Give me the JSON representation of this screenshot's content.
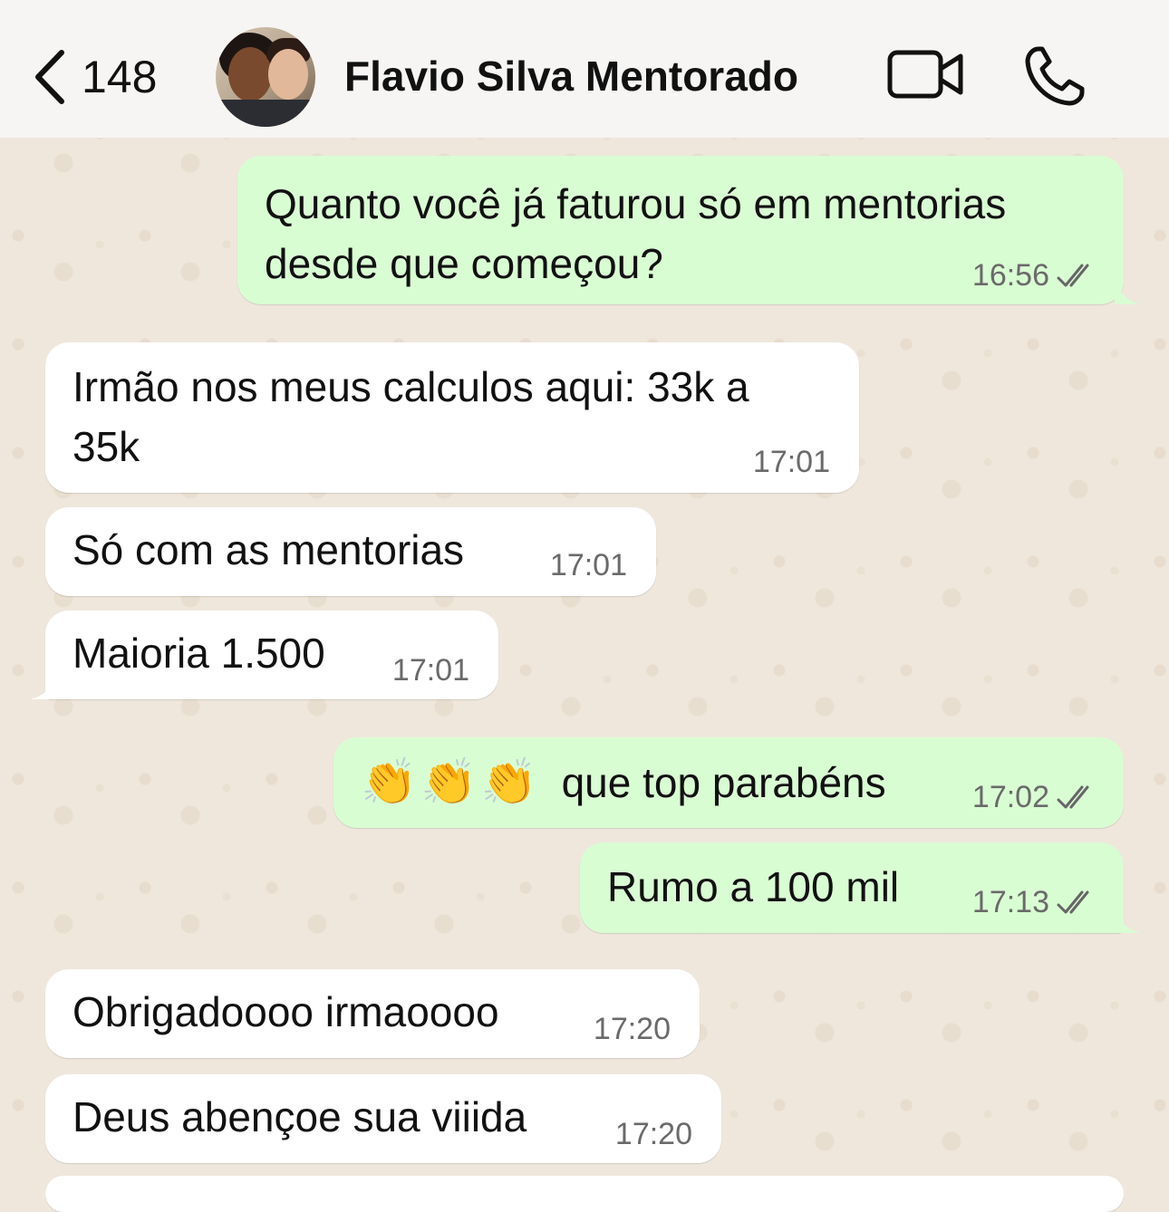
{
  "header": {
    "unread_count": "148",
    "contact_name": "Flavio Silva Mentorado",
    "back_icon": "chevron-left-icon",
    "video_icon": "video-camera-icon",
    "phone_icon": "phone-icon"
  },
  "messages": [
    {
      "direction": "outgoing",
      "lines": [
        "Quanto você já faturou só em mentorias",
        "desde que começou?"
      ],
      "time": "16:56",
      "status": "read"
    },
    {
      "direction": "incoming",
      "lines": [
        "Irmão nos meus calculos aqui: 33k a",
        "35k"
      ],
      "time": "17:01"
    },
    {
      "direction": "incoming",
      "text": "Só com as mentorias",
      "time": "17:01"
    },
    {
      "direction": "incoming",
      "text": "Maioria 1.500",
      "time": "17:01"
    },
    {
      "direction": "outgoing",
      "emoji": "👏👏👏",
      "text": "que top parabéns",
      "time": "17:02",
      "status": "read"
    },
    {
      "direction": "outgoing",
      "text": "Rumo a 100 mil",
      "time": "17:13",
      "status": "read"
    },
    {
      "direction": "incoming",
      "text": "Obrigadoooo irmaoooo",
      "time": "17:20"
    },
    {
      "direction": "incoming",
      "text": "Deus abençoe sua viiida",
      "time": "17:20"
    }
  ],
  "colors": {
    "outgoing_bubble": "#d9fdd3",
    "incoming_bubble": "#ffffff",
    "chat_background": "#efe7dc",
    "header_background": "#f6f5f3"
  }
}
